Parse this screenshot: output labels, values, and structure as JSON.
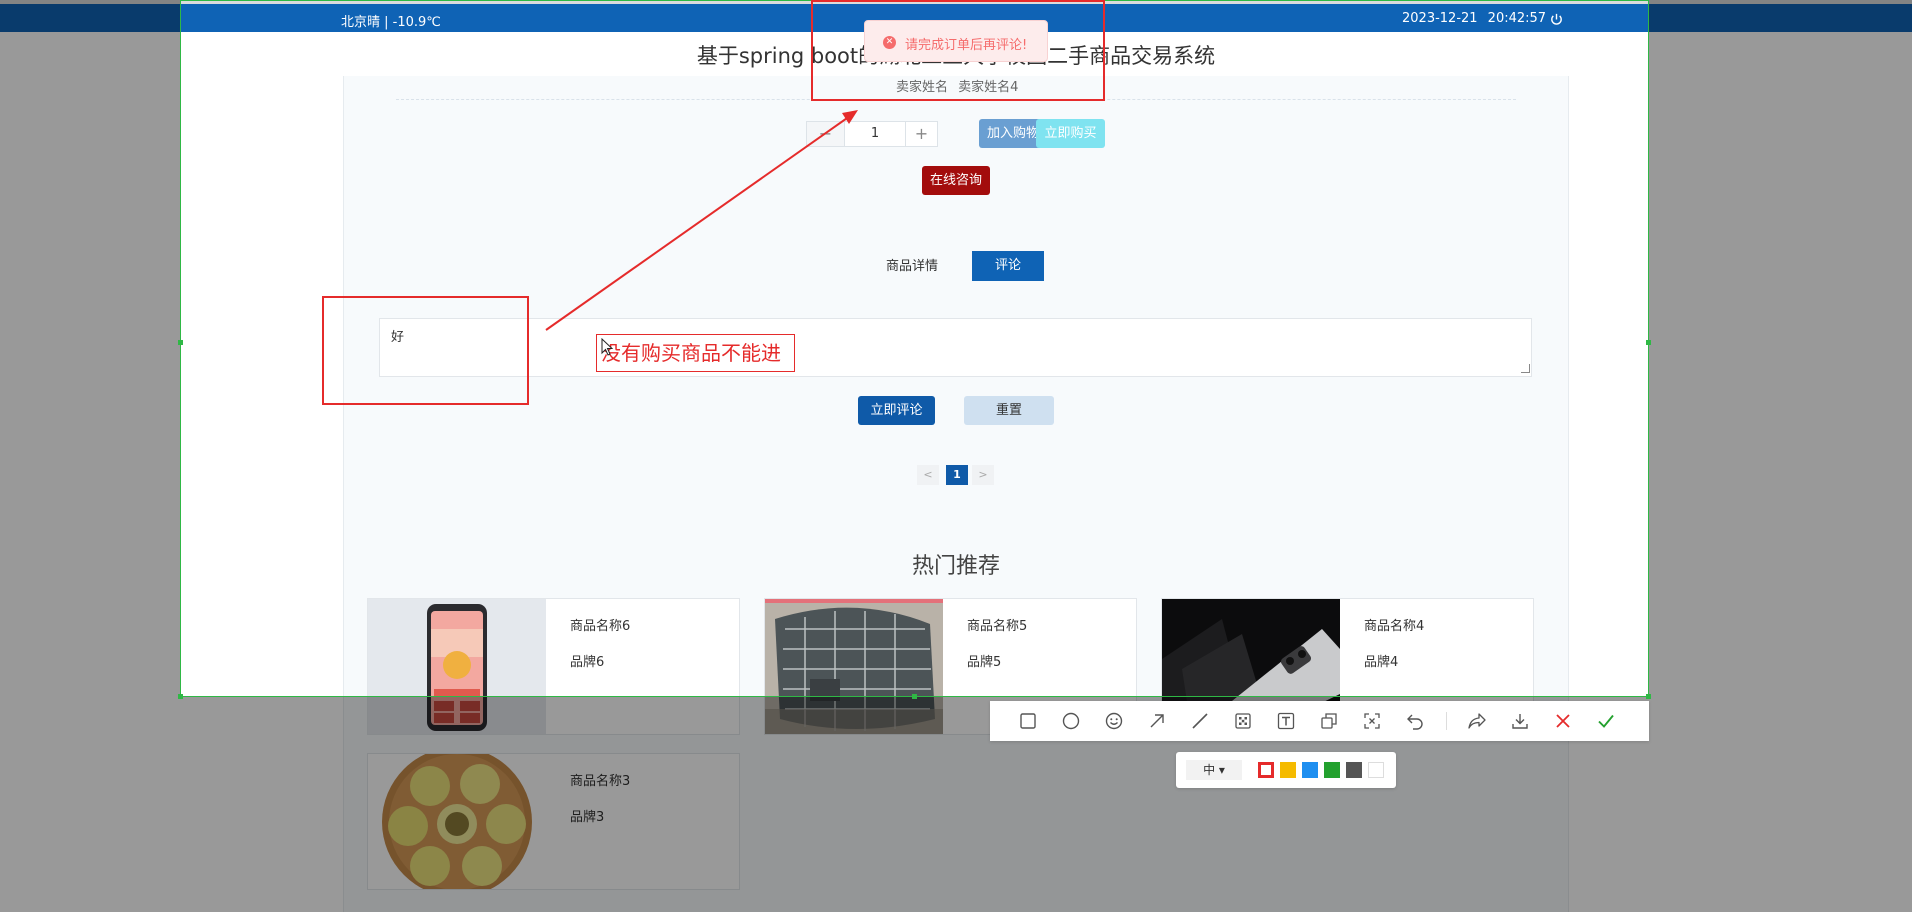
{
  "topbar": {
    "weather": "北京晴 | -10.9℃",
    "datetime": "2023-12-21  20:42:57",
    "power_icon": "power-icon"
  },
  "site_title": "基于spring boot的湖北工业大学校园二手商品交易系统",
  "seller": "卖家姓名  卖家姓名4",
  "quantity": {
    "minus": "−",
    "value": "1",
    "plus": "+"
  },
  "buttons": {
    "add_to_cart": "加入购物车",
    "buy_now": "立即购买",
    "consult": "在线咨询",
    "submit_review": "立即评论",
    "reset": "重置"
  },
  "tabs": {
    "detail": "商品详情",
    "review": "评论"
  },
  "comment": {
    "value": "好"
  },
  "pagination": {
    "prev": "<",
    "current": "1",
    "next": ">"
  },
  "hot": {
    "title": "热门推荐",
    "cards": [
      {
        "name": "商品名称6",
        "brand": "品牌6"
      },
      {
        "name": "商品名称5",
        "brand": "品牌5"
      },
      {
        "name": "商品名称4",
        "brand": "品牌4"
      },
      {
        "name": "商品名称3",
        "brand": "品牌3"
      }
    ]
  },
  "toast": {
    "message": "请完成订单后再评论!"
  },
  "annotation": {
    "text": "没有购买商品不能进"
  },
  "annotation_toolbar": {
    "tools": [
      "rectangle-icon",
      "ellipse-icon",
      "emoji-icon",
      "arrow-icon",
      "line-icon",
      "mosaic-icon",
      "text-icon",
      "copy-icon",
      "ocr-icon",
      "undo-icon",
      "share-icon",
      "download-icon",
      "cancel-icon",
      "confirm-icon"
    ],
    "size_label": "中 ▾",
    "colors": [
      "#e52b2b",
      "#f5bb00",
      "#1f8ff0",
      "#23a12e",
      "#555555",
      "#ffffff"
    ]
  },
  "colors": {
    "brand": "#0f63b5",
    "annotation": "#e52b2b",
    "selection": "#2fb845"
  }
}
